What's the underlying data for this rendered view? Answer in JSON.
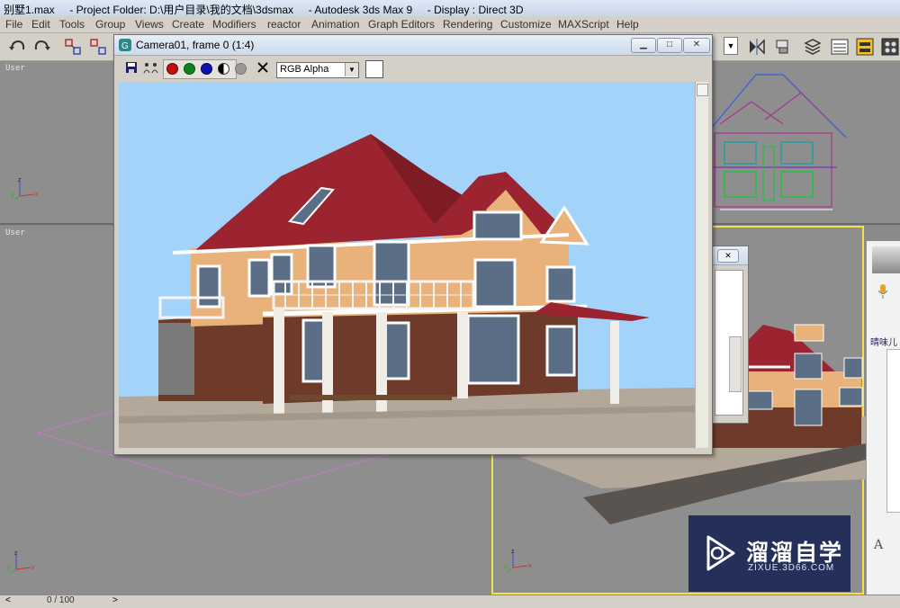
{
  "window": {
    "title": "别墅1.max     - Project Folder: D:\\用户目录\\我的文档\\3dsmax     - Autodesk 3ds Max 9     - Display : Direct 3D"
  },
  "menu": {
    "items": [
      "File",
      "Edit",
      "Tools",
      "Group",
      "Views",
      "Create",
      "Modifiers",
      "reactor",
      "Animation",
      "Graph Editors",
      "Rendering",
      "Customize",
      "MAXScript",
      "Help"
    ]
  },
  "viewports": {
    "top_left_label": "User",
    "bottom_left_label": "User",
    "axis_x": "x",
    "axis_y": "y",
    "axis_z": "z"
  },
  "frame_window": {
    "title": "Camera01, frame 0 (1:4)",
    "channel_select": "RGB Alpha",
    "minimize": "▁",
    "maximize": "□",
    "close": "✕"
  },
  "dialog2": {
    "close": "✕"
  },
  "chat_panel": {
    "text": "晴味儿",
    "font_btn": "A"
  },
  "status": {
    "time_slider": "0 / 100",
    "prev": "<",
    "next": ">"
  },
  "watermark": {
    "name": "溜溜自学",
    "url": "ZIXUE.3D66.COM"
  },
  "colors": {
    "sky": "#a3d3f8",
    "roof": "#9b2430",
    "wall": "#e8b27a",
    "brick": "#6e3a2a",
    "ground": "#b3a89a",
    "selection_border": "#f5e24a",
    "logo_bg": "#25305a"
  }
}
